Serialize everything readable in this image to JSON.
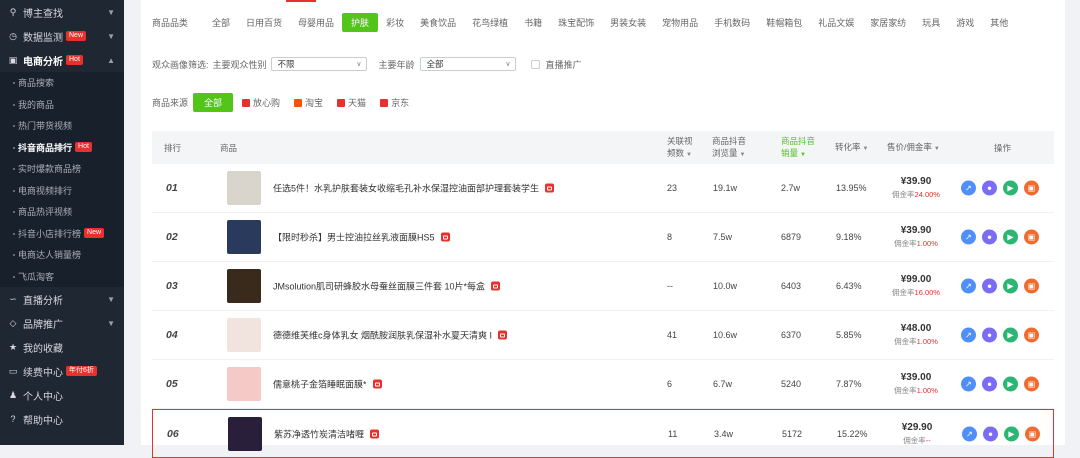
{
  "sidebar": {
    "items": [
      {
        "label": "博主查找",
        "icon": "user-search-icon",
        "badge": ""
      },
      {
        "label": "数据监测",
        "icon": "monitor-icon",
        "badge": "New"
      },
      {
        "label": "电商分析",
        "icon": "shop-icon",
        "badge": "Hot",
        "active": true
      }
    ],
    "subitems": [
      {
        "label": "商品搜索",
        "badge": ""
      },
      {
        "label": "我的商品",
        "badge": ""
      },
      {
        "label": "热门带货视频",
        "badge": ""
      },
      {
        "label": "抖音商品排行",
        "badge": "Hot",
        "active": true
      },
      {
        "label": "实时爆款商品榜",
        "badge": ""
      },
      {
        "label": "电商视频排行",
        "badge": ""
      },
      {
        "label": "商品热评视频",
        "badge": ""
      },
      {
        "label": "抖音小店排行榜",
        "badge": "New"
      },
      {
        "label": "电商达人销量榜",
        "badge": ""
      },
      {
        "label": "飞瓜淘客",
        "badge": ""
      }
    ],
    "bottom_items": [
      {
        "label": "直播分析",
        "icon": "live-icon",
        "badge": ""
      },
      {
        "label": "品牌推广",
        "icon": "diamond-icon",
        "badge": ""
      },
      {
        "label": "我的收藏",
        "icon": "star-icon",
        "badge": ""
      },
      {
        "label": "续费中心",
        "icon": "card-icon",
        "badge": "年付6折"
      },
      {
        "label": "个人中心",
        "icon": "person-icon",
        "badge": ""
      },
      {
        "label": "帮助中心",
        "icon": "help-icon",
        "badge": ""
      }
    ]
  },
  "filters": {
    "category_label": "商品品类",
    "categories": [
      "全部",
      "日用百货",
      "母婴用品",
      "护肤",
      "彩妆",
      "美食饮品",
      "花鸟绿植",
      "书籍",
      "珠宝配饰",
      "男装女装",
      "宠物用品",
      "手机数码",
      "鞋帽箱包",
      "礼品文娱",
      "家居家纺",
      "玩具",
      "游戏",
      "其他"
    ],
    "active_category": "护肤",
    "audience_label": "观众画像筛选:",
    "gender_label": "主要观众性别",
    "gender_value": "不限",
    "age_label": "主要年龄",
    "age_value": "全部",
    "live_promo_label": "直播推广",
    "source_label": "商品来源",
    "sources": [
      {
        "label": "全部",
        "active": true,
        "color": "#52c41a"
      },
      {
        "label": "放心购",
        "color": "#e8302e"
      },
      {
        "label": "淘宝",
        "color": "#ff5000"
      },
      {
        "label": "天猫",
        "color": "#e8302e"
      },
      {
        "label": "京东",
        "color": "#e8302e"
      }
    ]
  },
  "table": {
    "headers": {
      "rank": "排行",
      "product": "商品",
      "videos": "关联视频数",
      "views": "商品抖音浏览量",
      "sales": "商品抖音销量",
      "conversion": "转化率",
      "price": "售价/佣金率",
      "actions": "操作"
    },
    "commission_prefix": "佣金率",
    "rows": [
      {
        "rank": "01",
        "title": "任选5件！水乳护肤套装女收缩毛孔补水保湿控油面部护理套装学生",
        "videos": "23",
        "views": "19.1w",
        "sales": "2.7w",
        "conversion": "13.95%",
        "price": "¥39.90",
        "commission": "24.00%",
        "thumb": "#d9d4cc"
      },
      {
        "rank": "02",
        "title": "【限时秒杀】男士控油拉丝乳液面膜HS5",
        "videos": "8",
        "views": "7.5w",
        "sales": "6879",
        "conversion": "9.18%",
        "price": "¥39.90",
        "commission": "1.00%",
        "thumb": "#2a3a5c"
      },
      {
        "rank": "03",
        "title": "JMsolution肌司研蜂胶水母蚕丝面膜三件套 10片*每盒",
        "videos": "--",
        "views": "10.0w",
        "sales": "6403",
        "conversion": "6.43%",
        "price": "¥99.00",
        "commission": "16.00%",
        "thumb": "#3a2a1c"
      },
      {
        "rank": "04",
        "title": "德德维芙维c身体乳女 烟酰胺润肤乳保湿补水夏天清爽 I",
        "videos": "41",
        "views": "10.6w",
        "sales": "6370",
        "conversion": "5.85%",
        "price": "¥48.00",
        "commission": "1.00%",
        "thumb": "#f1e4df"
      },
      {
        "rank": "05",
        "title": "儒意桃子金箔睡眠面膜*",
        "videos": "6",
        "views": "6.7w",
        "sales": "5240",
        "conversion": "7.87%",
        "price": "¥39.00",
        "commission": "1.00%",
        "thumb": "#f4c9c6"
      },
      {
        "rank": "06",
        "title": "紫苏净透竹炭清洁啫喱",
        "videos": "11",
        "views": "3.4w",
        "sales": "5172",
        "conversion": "15.22%",
        "price": "¥29.90",
        "commission": "--",
        "thumb": "#2a1f3a"
      }
    ]
  }
}
